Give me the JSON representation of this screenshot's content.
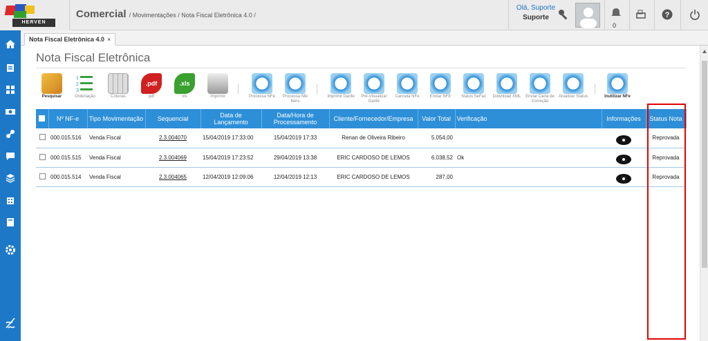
{
  "app": {
    "logo_text": "HERVEN",
    "module": "Comercial",
    "crumb": "/ Movimentações / Nota Fiscal Eletrônica 4.0 /",
    "sep": " / "
  },
  "user": {
    "greeting": "Olá, Suporte",
    "name": "Suporte",
    "notifications": "0"
  },
  "tab": {
    "label": "Nota Fiscal Eletrônica 4.0",
    "close": "×"
  },
  "page": {
    "title": "Nota Fiscal Eletrônica"
  },
  "toolbar": [
    {
      "label": "Pesquisar",
      "icon": "search-icon"
    },
    {
      "label": "Ordenação",
      "icon": "list-icon"
    },
    {
      "label": "Colunas",
      "icon": "columns-icon"
    },
    {
      "label": "pdf",
      "icon": "pdf-icon"
    },
    {
      "label": "xls",
      "icon": "xls-icon"
    },
    {
      "label": "Imprimir",
      "icon": "printer-icon"
    },
    {
      "label": "Processa NFe",
      "icon": "nfe-process-icon"
    },
    {
      "label": "Processa Nfe Itens",
      "icon": "nfe-items-icon"
    },
    {
      "label": "Imprimir Danfe",
      "icon": "danfe-print-icon"
    },
    {
      "label": "Pré-Visualizar Danfe",
      "icon": "danfe-preview-icon"
    },
    {
      "label": "Cancela NFe",
      "icon": "nfe-cancel-icon"
    },
    {
      "label": "Enviar NFE",
      "icon": "nfe-send-icon"
    },
    {
      "label": "Status SeFaz",
      "icon": "sefaz-status-icon"
    },
    {
      "label": "Download XML",
      "icon": "xml-download-icon"
    },
    {
      "label": "Enviar Carta de Correção",
      "icon": "correction-letter-icon"
    },
    {
      "label": "Atualizar Status",
      "icon": "refresh-status-icon"
    },
    {
      "label": "Inutilizar NFe",
      "icon": "nfe-disable-icon"
    }
  ],
  "table": {
    "headers": {
      "nf": "Nº NF-e",
      "tipo": "Tipo Movimentação",
      "seq": "Sequencial",
      "data": "Data de Lançamento",
      "proc": "Data/Hora de Processamento",
      "cliente": "Cliente/Fornecedor/Empresa",
      "valor": "Valor Total",
      "verif": "Verificação",
      "info": "Informações",
      "status": "Status Nota"
    },
    "rows": [
      {
        "nf": "000.015.516",
        "tipo": "Venda Fiscal",
        "seq": "2.3.004070",
        "data": "15/04/2019 17:33:00",
        "proc": "15/04/2019 17:33",
        "cliente": "Renan de Oliveira Ribeiro",
        "valor": "5.054,00",
        "verif": "",
        "status": "Reprovada"
      },
      {
        "nf": "000.015.515",
        "tipo": "Venda Fiscal",
        "seq": "2.3.004069",
        "data": "15/04/2019 17:23:52",
        "proc": "29/04/2019 13:38",
        "cliente": "ERIC CARDOSO DE LEMOS",
        "valor": "6.038,52",
        "verif": "Ok",
        "status": "Reprovada"
      },
      {
        "nf": "000.015.514",
        "tipo": "Venda Fiscal",
        "seq": "2.3.004065",
        "data": "12/04/2019 12:09:06",
        "proc": "12/04/2019 12:13",
        "cliente": "ERIC CARDOSO DE LEMOS",
        "valor": "287,00",
        "verif": "",
        "status": "Reprovada"
      }
    ]
  },
  "colors": {
    "accent": "#2d8fd8",
    "sidebar": "#1e78c8",
    "reprovada": "#d01010",
    "aprovada": "#1a8a1a",
    "highlight": "#e00000"
  }
}
